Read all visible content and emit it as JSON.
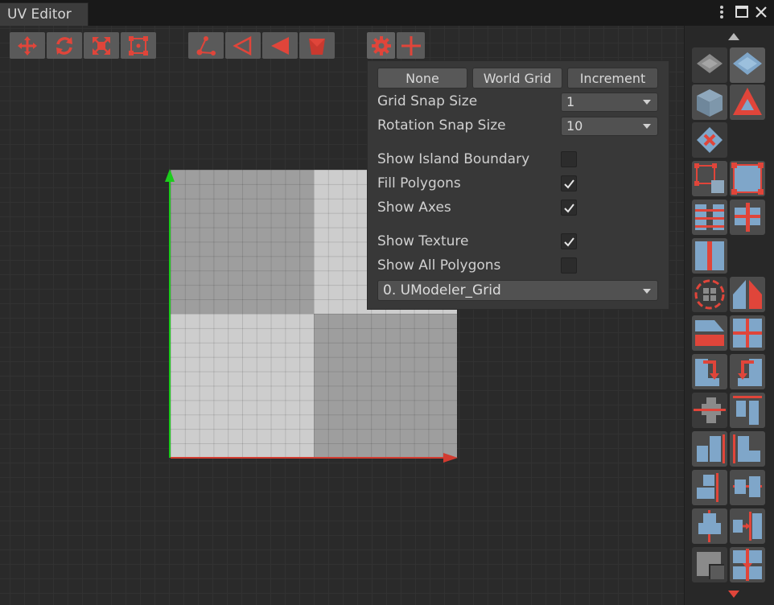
{
  "window": {
    "tab_title": "UV Editor",
    "menu_icon": "kebab-menu-icon",
    "maximize_icon": "maximize-icon",
    "close_icon": "close-icon"
  },
  "colors": {
    "accent": "#e0453a",
    "axis_y": "#1ccc1c",
    "axis_x": "#d23b30",
    "panel": "#383838"
  },
  "toolbar": {
    "transform_tools": [
      "move-icon",
      "rotate-icon",
      "scale-icon",
      "rect-transform-icon"
    ],
    "select_modes": [
      "vertex-select-icon",
      "edge-select-icon",
      "face-select-icon",
      "object-select-icon"
    ],
    "extra": [
      "settings-icon",
      "pivot-icon"
    ]
  },
  "snap_panel": {
    "snap_modes": [
      {
        "label": "None",
        "active": false
      },
      {
        "label": "World Grid",
        "active": false
      },
      {
        "label": "Increment",
        "active": true
      }
    ],
    "grid_snap_label": "Grid Snap Size",
    "grid_snap_value": "1",
    "rotation_snap_label": "Rotation Snap Size",
    "rotation_snap_value": "10",
    "options": [
      {
        "label": "Show Island Boundary",
        "checked": false
      },
      {
        "label": "Fill Polygons",
        "checked": true
      },
      {
        "label": "Show Axes",
        "checked": true
      },
      {
        "label": "Show Texture",
        "checked": true
      },
      {
        "label": "Show All Polygons",
        "checked": false
      }
    ],
    "texture_value": "0. UModeler_Grid"
  },
  "side_tools": [
    "uv-plane-icon",
    "uv-plane-selected-icon",
    "uv-cube-icon",
    "uv-triangle-icon",
    "uv-delete-icon",
    "uv-bounds-icon",
    "uv-fit-icon",
    "uv-stack-icon",
    "uv-split-icon",
    "uv-mirror-icon",
    "uv-rotate-icon",
    "uv-flip-icon",
    "uv-cut-icon",
    "uv-cross-icon",
    "uv-move-down-left-icon",
    "uv-move-down-right-icon",
    "uv-align-center-h-icon",
    "uv-align-top-icon",
    "uv-align-bottom-icon",
    "uv-align-left-icon",
    "uv-align-right-icon",
    "uv-align-middle-icon",
    "uv-align-center-v-icon",
    "uv-distribute-icon",
    "uv-snap-corner-icon",
    "uv-snap-center-icon"
  ]
}
